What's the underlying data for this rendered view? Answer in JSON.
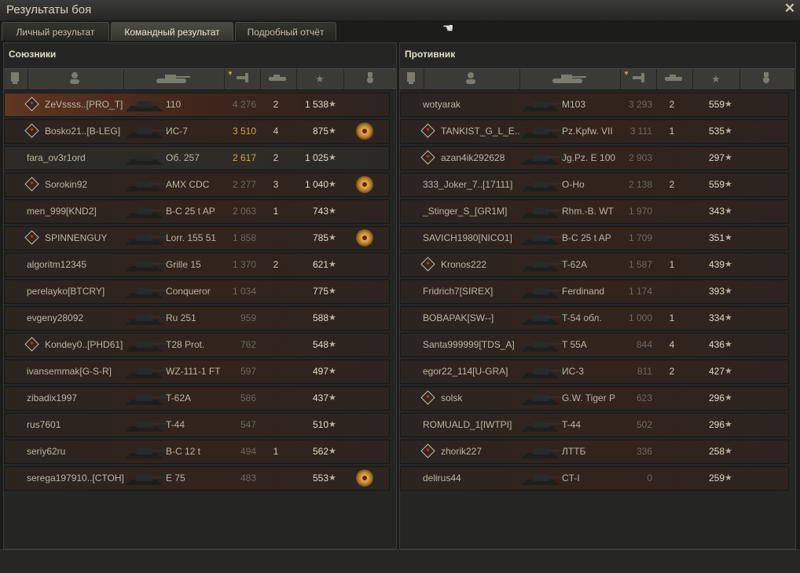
{
  "window": {
    "title": "Результаты боя"
  },
  "tabs": [
    "Личный результат",
    "Командный результат",
    "Подробный отчёт"
  ],
  "active_tab": 1,
  "allies": {
    "title": "Союзники",
    "rows": [
      {
        "name": "ZeVssss..[PRO_T]",
        "platoon": true,
        "tank": "110",
        "damage": "4 276",
        "damage_gold": false,
        "kills": "2",
        "xp": "1 538",
        "medal": false,
        "highlight": true
      },
      {
        "name": "Bosko21..[B-LEG]",
        "platoon": true,
        "tank": "ИС-7",
        "damage": "3 510",
        "damage_gold": true,
        "kills": "4",
        "xp": "875",
        "medal": true
      },
      {
        "name": "fara_ov3r1ord",
        "platoon": false,
        "tank": "Об. 257",
        "damage": "2 617",
        "damage_gold": true,
        "kills": "2",
        "xp": "1 025",
        "medal": false
      },
      {
        "name": "Sorokin92",
        "platoon": true,
        "tank": "AMX CDC",
        "damage": "2 277",
        "damage_gold": false,
        "kills": "3",
        "xp": "1 040",
        "medal": true
      },
      {
        "name": "men_999[KND2]",
        "platoon": false,
        "tank": "B-C 25 t AP",
        "damage": "2 063",
        "damage_gold": false,
        "kills": "1",
        "xp": "743",
        "medal": false
      },
      {
        "name": "SPINNENGUY",
        "platoon": true,
        "tank": "Lorr. 155 51",
        "damage": "1 858",
        "damage_gold": false,
        "kills": "",
        "xp": "785",
        "medal": true
      },
      {
        "name": "algoritm12345",
        "platoon": false,
        "tank": "Grille 15",
        "damage": "1 370",
        "damage_gold": false,
        "kills": "2",
        "xp": "621",
        "medal": false
      },
      {
        "name": "perelayko[BTCRY]",
        "platoon": false,
        "tank": "Conqueror",
        "damage": "1 034",
        "damage_gold": false,
        "kills": "",
        "xp": "775",
        "medal": false
      },
      {
        "name": "evgeny28092",
        "platoon": false,
        "tank": "Ru 251",
        "damage": "959",
        "damage_gold": false,
        "kills": "",
        "xp": "588",
        "medal": false
      },
      {
        "name": "Kondey0..[PHD61]",
        "platoon": true,
        "tank": "T28 Prot.",
        "damage": "762",
        "damage_gold": false,
        "kills": "",
        "xp": "548",
        "medal": false
      },
      {
        "name": "ivansemmak[G-S-R]",
        "platoon": false,
        "tank": "WZ-111-1 FT",
        "damage": "597",
        "damage_gold": false,
        "kills": "",
        "xp": "497",
        "medal": false
      },
      {
        "name": "zibadix1997",
        "platoon": false,
        "tank": "T-62A",
        "damage": "586",
        "damage_gold": false,
        "kills": "",
        "xp": "437",
        "medal": false
      },
      {
        "name": "rus7601",
        "platoon": false,
        "tank": "T-44",
        "damage": "547",
        "damage_gold": false,
        "kills": "",
        "xp": "510",
        "medal": false
      },
      {
        "name": "seriy62ru",
        "platoon": false,
        "tank": "B-C 12 t",
        "damage": "494",
        "damage_gold": false,
        "kills": "1",
        "xp": "562",
        "medal": false
      },
      {
        "name": "serega197910..[CTOH]",
        "platoon": false,
        "tank": "E 75",
        "damage": "483",
        "damage_gold": false,
        "kills": "",
        "xp": "553",
        "medal": true
      }
    ]
  },
  "enemies": {
    "title": "Противник",
    "rows": [
      {
        "name": "wotyarak",
        "platoon": false,
        "tank": "M103",
        "damage": "3 293",
        "kills": "2",
        "xp": "559"
      },
      {
        "name": "TANKIST_G_L_E..",
        "platoon": true,
        "tank": "Pz.Kpfw. VII",
        "damage": "3 111",
        "kills": "1",
        "xp": "535"
      },
      {
        "name": "azan4ik292628",
        "platoon": true,
        "tank": "Jg.Pz. E 100",
        "damage": "2 903",
        "kills": "",
        "xp": "297"
      },
      {
        "name": "333_Joker_7..[17111]",
        "platoon": false,
        "tank": "O-Ho",
        "damage": "2 138",
        "kills": "2",
        "xp": "559"
      },
      {
        "name": "_Stinger_S_[GR1M]",
        "platoon": false,
        "tank": "Rhm.-B. WT",
        "damage": "1 970",
        "kills": "",
        "xp": "343"
      },
      {
        "name": "SAVICH1980[NICO1]",
        "platoon": false,
        "tank": "B-C 25 t AP",
        "damage": "1 709",
        "kills": "",
        "xp": "351"
      },
      {
        "name": "Kronos222",
        "platoon": true,
        "tank": "T-62A",
        "damage": "1 587",
        "kills": "1",
        "xp": "439"
      },
      {
        "name": "Fridrich7[SIREX]",
        "platoon": false,
        "tank": "Ferdinand",
        "damage": "1 174",
        "kills": "",
        "xp": "393"
      },
      {
        "name": "BOBAPAK[SW--]",
        "platoon": false,
        "tank": "T-54 обл.",
        "damage": "1 000",
        "kills": "1",
        "xp": "334"
      },
      {
        "name": "Santa999999[TDS_A]",
        "platoon": false,
        "tank": "T 55A",
        "damage": "844",
        "kills": "4",
        "xp": "436"
      },
      {
        "name": "egor22_114[U-GRA]",
        "platoon": false,
        "tank": "ИС-3",
        "damage": "811",
        "kills": "2",
        "xp": "427"
      },
      {
        "name": "solsk",
        "platoon": true,
        "tank": "G.W. Tiger P",
        "damage": "623",
        "kills": "",
        "xp": "296"
      },
      {
        "name": "ROMUALD_1[IWTPI]",
        "platoon": false,
        "tank": "T-44",
        "damage": "502",
        "kills": "",
        "xp": "296"
      },
      {
        "name": "zhorik227",
        "platoon": true,
        "tank": "ЛТТБ",
        "damage": "336",
        "kills": "",
        "xp": "258"
      },
      {
        "name": "delirus44",
        "platoon": false,
        "tank": "CT-I",
        "damage": "0",
        "kills": "",
        "xp": "259"
      }
    ]
  },
  "icons": {
    "close": "close-icon",
    "cursor": "hand-cursor-icon",
    "star": "star-icon",
    "medal": "medal-icon",
    "platoon": "platoon-icon",
    "player": "player-icon",
    "tank": "tank-icon",
    "damage": "damage-icon",
    "kills": "kills-icon",
    "level": "level-icon"
  },
  "colors": {
    "gold": "#d2a64a",
    "highlight": "#5e3622",
    "row": "#33231d"
  }
}
